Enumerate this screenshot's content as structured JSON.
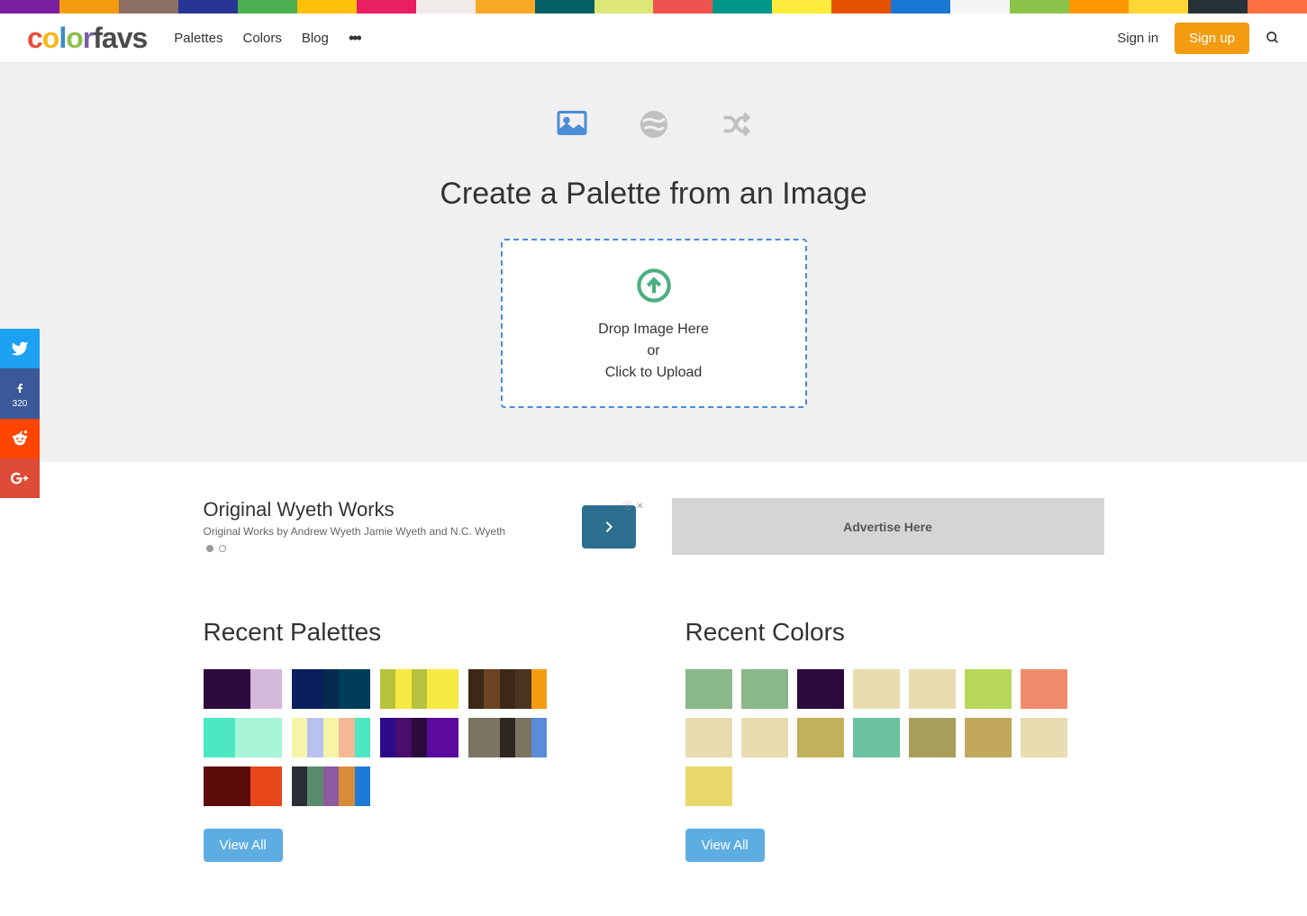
{
  "topStripe": [
    "#7b1fa2",
    "#f39c12",
    "#8d6e63",
    "#283593",
    "#4caf50",
    "#ffc107",
    "#e91e63",
    "#efebe9",
    "#f9a825",
    "#006064",
    "#dce775",
    "#ef5350",
    "#009688",
    "#ffeb3b",
    "#e65100",
    "#1976d2",
    "#f5f5f5",
    "#8bc34a",
    "#ff9800",
    "#fdd835",
    "#263238",
    "#ff7043"
  ],
  "nav": {
    "palettes": "Palettes",
    "colors": "Colors",
    "blog": "Blog",
    "signin": "Sign in",
    "signup": "Sign up"
  },
  "hero": {
    "title": "Create a Palette from an Image",
    "drop1": "Drop Image Here",
    "drop2": "or",
    "drop3": "Click to Upload"
  },
  "social": {
    "fbCount": "320"
  },
  "ads": {
    "leftTitle": "Original Wyeth Works",
    "leftSub": "Original Works by Andrew Wyeth Jamie Wyeth and N.C. Wyeth",
    "rightLabel": "Advertise Here"
  },
  "recent": {
    "palettesTitle": "Recent Palettes",
    "colorsTitle": "Recent Colors",
    "viewAll": "View All",
    "palettes": [
      [
        "#2d0a3d",
        "#2d0a3d",
        "#2d0a3d",
        "#d3b8dc",
        "#d3b8dc"
      ],
      [
        "#0a1f5c",
        "#0a1f5c",
        "#062b4f",
        "#003d5c",
        "#003d5c"
      ],
      [
        "#b8c23e",
        "#f5e942",
        "#b8c23e",
        "#f5e942",
        "#f5e942"
      ],
      [
        "#3d2817",
        "#6b4423",
        "#3d2817",
        "#4a3520",
        "#f39c12"
      ],
      [
        "#4de8c1",
        "#4de8c1",
        "#a8f5d8",
        "#a8f5d8",
        "#a8f5d8"
      ],
      [
        "#f5f5a8",
        "#b8c2f0",
        "#f5f5a8",
        "#f5b896",
        "#4de8c1"
      ],
      [
        "#2d0a8c",
        "#4a0d6b",
        "#2d0a3d",
        "#5c0a9e",
        "#5c0a9e"
      ],
      [
        "#7a7560",
        "#7a7560",
        "#2d2820",
        "#7a7560",
        "#5a8cd8"
      ],
      [
        "#5c0a0a",
        "#5c0a0a",
        "#5c0a0a",
        "#e8471c",
        "#e8471c"
      ],
      [
        "#2a2e35",
        "#5a8c6b",
        "#8c5a9e",
        "#d88c3a",
        "#1e7ad8"
      ]
    ],
    "colors": [
      "#8bb888",
      "#8bb888",
      "#2d0a3d",
      "#e8dcb0",
      "#e8dcb0",
      "#b8d85a",
      "#f08c6b",
      "#e8dcb0",
      "#e8dcb0",
      "#c2b05a",
      "#6bc29e",
      "#a89e5a",
      "#c2a85a",
      "#e8dcb0",
      "#e8d86b"
    ]
  }
}
